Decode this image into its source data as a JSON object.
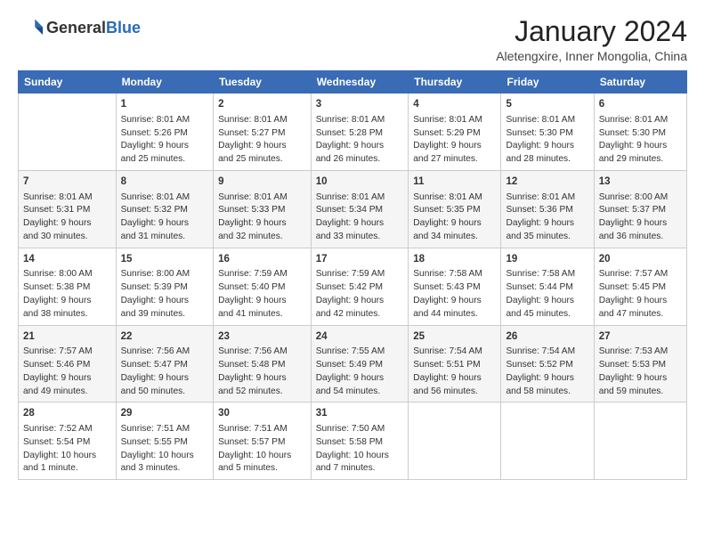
{
  "header": {
    "logo_general": "General",
    "logo_blue": "Blue",
    "month_year": "January 2024",
    "location": "Aletengxire, Inner Mongolia, China"
  },
  "days_of_week": [
    "Sunday",
    "Monday",
    "Tuesday",
    "Wednesday",
    "Thursday",
    "Friday",
    "Saturday"
  ],
  "weeks": [
    [
      {
        "date": "",
        "content": ""
      },
      {
        "date": "1",
        "content": "Sunrise: 8:01 AM\nSunset: 5:26 PM\nDaylight: 9 hours\nand 25 minutes."
      },
      {
        "date": "2",
        "content": "Sunrise: 8:01 AM\nSunset: 5:27 PM\nDaylight: 9 hours\nand 25 minutes."
      },
      {
        "date": "3",
        "content": "Sunrise: 8:01 AM\nSunset: 5:28 PM\nDaylight: 9 hours\nand 26 minutes."
      },
      {
        "date": "4",
        "content": "Sunrise: 8:01 AM\nSunset: 5:29 PM\nDaylight: 9 hours\nand 27 minutes."
      },
      {
        "date": "5",
        "content": "Sunrise: 8:01 AM\nSunset: 5:30 PM\nDaylight: 9 hours\nand 28 minutes."
      },
      {
        "date": "6",
        "content": "Sunrise: 8:01 AM\nSunset: 5:30 PM\nDaylight: 9 hours\nand 29 minutes."
      }
    ],
    [
      {
        "date": "7",
        "content": "Sunrise: 8:01 AM\nSunset: 5:31 PM\nDaylight: 9 hours\nand 30 minutes."
      },
      {
        "date": "8",
        "content": "Sunrise: 8:01 AM\nSunset: 5:32 PM\nDaylight: 9 hours\nand 31 minutes."
      },
      {
        "date": "9",
        "content": "Sunrise: 8:01 AM\nSunset: 5:33 PM\nDaylight: 9 hours\nand 32 minutes."
      },
      {
        "date": "10",
        "content": "Sunrise: 8:01 AM\nSunset: 5:34 PM\nDaylight: 9 hours\nand 33 minutes."
      },
      {
        "date": "11",
        "content": "Sunrise: 8:01 AM\nSunset: 5:35 PM\nDaylight: 9 hours\nand 34 minutes."
      },
      {
        "date": "12",
        "content": "Sunrise: 8:01 AM\nSunset: 5:36 PM\nDaylight: 9 hours\nand 35 minutes."
      },
      {
        "date": "13",
        "content": "Sunrise: 8:00 AM\nSunset: 5:37 PM\nDaylight: 9 hours\nand 36 minutes."
      }
    ],
    [
      {
        "date": "14",
        "content": "Sunrise: 8:00 AM\nSunset: 5:38 PM\nDaylight: 9 hours\nand 38 minutes."
      },
      {
        "date": "15",
        "content": "Sunrise: 8:00 AM\nSunset: 5:39 PM\nDaylight: 9 hours\nand 39 minutes."
      },
      {
        "date": "16",
        "content": "Sunrise: 7:59 AM\nSunset: 5:40 PM\nDaylight: 9 hours\nand 41 minutes."
      },
      {
        "date": "17",
        "content": "Sunrise: 7:59 AM\nSunset: 5:42 PM\nDaylight: 9 hours\nand 42 minutes."
      },
      {
        "date": "18",
        "content": "Sunrise: 7:58 AM\nSunset: 5:43 PM\nDaylight: 9 hours\nand 44 minutes."
      },
      {
        "date": "19",
        "content": "Sunrise: 7:58 AM\nSunset: 5:44 PM\nDaylight: 9 hours\nand 45 minutes."
      },
      {
        "date": "20",
        "content": "Sunrise: 7:57 AM\nSunset: 5:45 PM\nDaylight: 9 hours\nand 47 minutes."
      }
    ],
    [
      {
        "date": "21",
        "content": "Sunrise: 7:57 AM\nSunset: 5:46 PM\nDaylight: 9 hours\nand 49 minutes."
      },
      {
        "date": "22",
        "content": "Sunrise: 7:56 AM\nSunset: 5:47 PM\nDaylight: 9 hours\nand 50 minutes."
      },
      {
        "date": "23",
        "content": "Sunrise: 7:56 AM\nSunset: 5:48 PM\nDaylight: 9 hours\nand 52 minutes."
      },
      {
        "date": "24",
        "content": "Sunrise: 7:55 AM\nSunset: 5:49 PM\nDaylight: 9 hours\nand 54 minutes."
      },
      {
        "date": "25",
        "content": "Sunrise: 7:54 AM\nSunset: 5:51 PM\nDaylight: 9 hours\nand 56 minutes."
      },
      {
        "date": "26",
        "content": "Sunrise: 7:54 AM\nSunset: 5:52 PM\nDaylight: 9 hours\nand 58 minutes."
      },
      {
        "date": "27",
        "content": "Sunrise: 7:53 AM\nSunset: 5:53 PM\nDaylight: 9 hours\nand 59 minutes."
      }
    ],
    [
      {
        "date": "28",
        "content": "Sunrise: 7:52 AM\nSunset: 5:54 PM\nDaylight: 10 hours\nand 1 minute."
      },
      {
        "date": "29",
        "content": "Sunrise: 7:51 AM\nSunset: 5:55 PM\nDaylight: 10 hours\nand 3 minutes."
      },
      {
        "date": "30",
        "content": "Sunrise: 7:51 AM\nSunset: 5:57 PM\nDaylight: 10 hours\nand 5 minutes."
      },
      {
        "date": "31",
        "content": "Sunrise: 7:50 AM\nSunset: 5:58 PM\nDaylight: 10 hours\nand 7 minutes."
      },
      {
        "date": "",
        "content": ""
      },
      {
        "date": "",
        "content": ""
      },
      {
        "date": "",
        "content": ""
      }
    ]
  ]
}
